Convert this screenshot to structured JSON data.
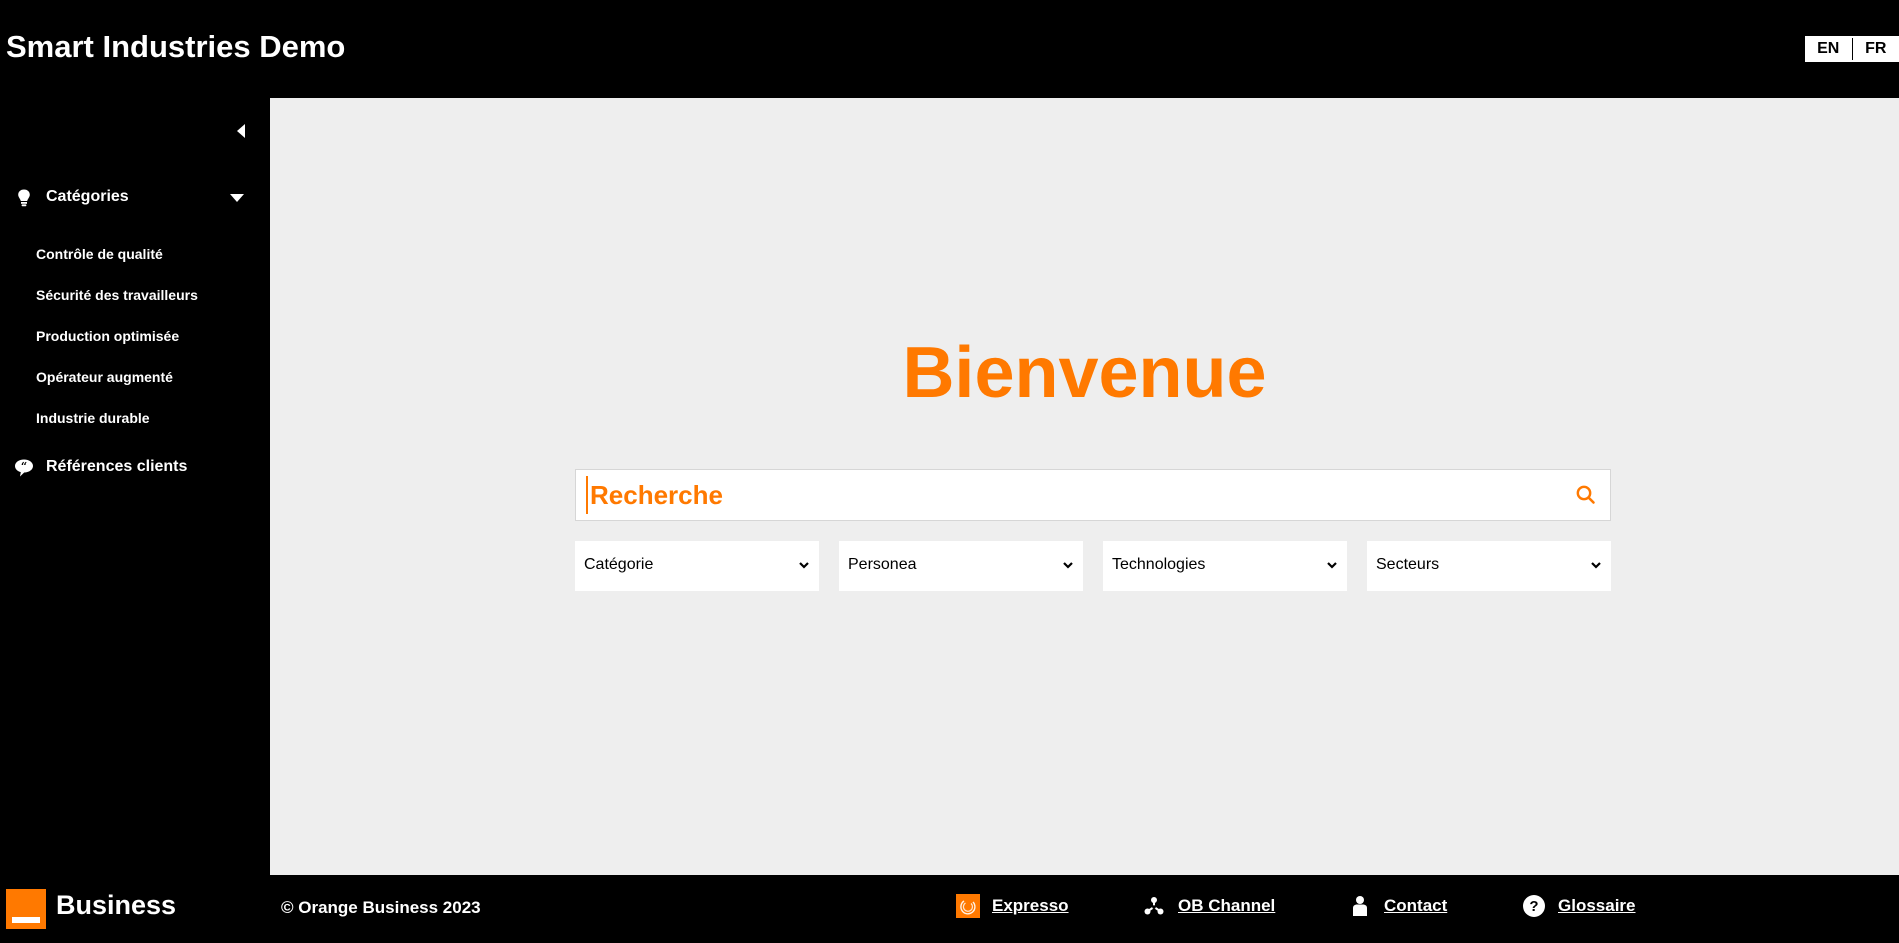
{
  "header": {
    "title": "Smart Industries Demo",
    "languages": [
      {
        "code": "EN"
      },
      {
        "code": "FR"
      }
    ]
  },
  "sidebar": {
    "collapse_icon": "caret-left-icon",
    "categories": {
      "label": "Catégories",
      "icon": "lightbulb-icon",
      "expanded": true,
      "items": [
        {
          "label": "Contrôle de qualité"
        },
        {
          "label": "Sécurité des travailleurs"
        },
        {
          "label": "Production optimisée"
        },
        {
          "label": "Opérateur augmenté"
        },
        {
          "label": "Industrie durable"
        }
      ]
    },
    "references": {
      "label": "Références clients",
      "icon": "quote-bubble-icon"
    }
  },
  "main": {
    "welcome": "Bienvenue",
    "search": {
      "placeholder": "Recherche",
      "value": "",
      "icon": "search-icon"
    },
    "filters": [
      {
        "label": "Catégorie"
      },
      {
        "label": "Personea"
      },
      {
        "label": "Technologies"
      },
      {
        "label": "Secteurs"
      }
    ]
  },
  "footer": {
    "brand": "Business",
    "copyright": "© Orange Business 2023",
    "links": [
      {
        "label": "Expresso",
        "icon": "expresso-icon"
      },
      {
        "label": "OB Channel",
        "icon": "network-icon"
      },
      {
        "label": "Contact",
        "icon": "person-icon"
      },
      {
        "label": "Glossaire",
        "icon": "question-circle-icon"
      }
    ]
  },
  "colors": {
    "accent": "#ff7900",
    "background_main": "#eeeeee",
    "chrome": "#000000"
  }
}
